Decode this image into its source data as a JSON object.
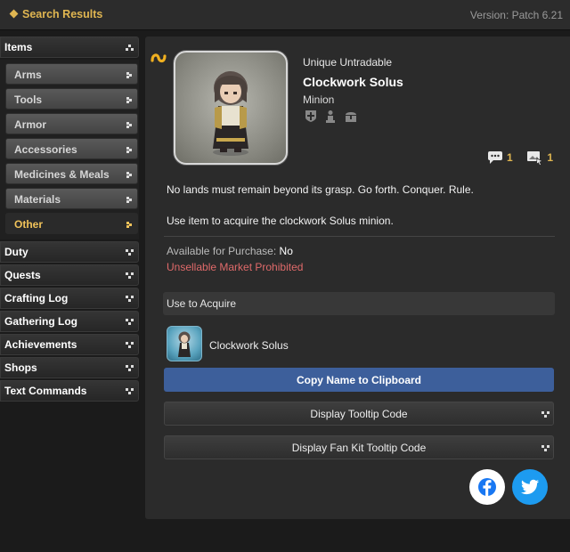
{
  "topbar": {
    "breadcrumb": "Search Results",
    "version": "Version: Patch 6.21"
  },
  "sidebar": {
    "items_label": "Items",
    "sub_items": [
      {
        "label": "Arms"
      },
      {
        "label": "Tools"
      },
      {
        "label": "Armor"
      },
      {
        "label": "Accessories"
      },
      {
        "label": "Medicines & Meals"
      },
      {
        "label": "Materials"
      },
      {
        "label": "Other",
        "active": true
      }
    ],
    "categories": [
      {
        "label": "Duty"
      },
      {
        "label": "Quests"
      },
      {
        "label": "Crafting Log"
      },
      {
        "label": "Gathering Log"
      },
      {
        "label": "Achievements"
      },
      {
        "label": "Shops"
      },
      {
        "label": "Text Commands"
      }
    ]
  },
  "item": {
    "flags": "Unique Untradable",
    "name": "Clockwork Solus",
    "type": "Minion",
    "flag_icons": [
      "cross-shield-icon",
      "bust-icon",
      "chest-icon"
    ],
    "comment_count": "1",
    "screenshot_count": "1",
    "description": "No lands must remain beyond its grasp. Go forth. Conquer. Rule.",
    "use_text": "Use item to acquire the clockwork Solus minion.",
    "availability_label": "Available for Purchase:",
    "availability_value": "No",
    "market_status": "Unsellable Market Prohibited"
  },
  "acquire": {
    "header": "Use to Acquire",
    "entry_name": "Clockwork Solus"
  },
  "buttons": {
    "copy_name": "Copy Name to Clipboard",
    "tooltip_code": "Display Tooltip Code",
    "fankit_code": "Display Fan Kit Tooltip Code"
  },
  "social": [
    "facebook-icon",
    "twitter-icon"
  ],
  "colors": {
    "accent": "#e0b651",
    "button_primary": "#3d5f9b",
    "warning_text": "#e06a6a",
    "twitter": "#1d9bf0",
    "facebook": "#1877f2"
  }
}
